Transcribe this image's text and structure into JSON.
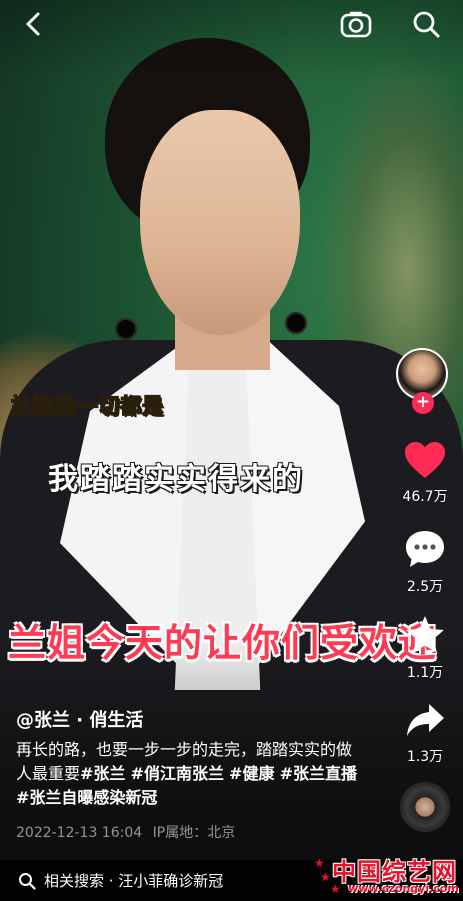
{
  "top_bar": {
    "back_icon": "chevron-left-icon",
    "camera_icon": "camera-icon",
    "search_icon": "search-icon"
  },
  "captions": {
    "line1": "兰姐的一切都是",
    "line2": "我踏踏实实得来的",
    "line3": "兰姐今天的让你们受欢迎"
  },
  "right_rail": {
    "like_count": "46.7万",
    "comment_count": "2.5万",
    "favorite_count": "1.1万",
    "share_count": "1.3万",
    "follow_symbol": "+",
    "colors": {
      "like": "#fe2c55",
      "follow": "#fe2c55"
    }
  },
  "post": {
    "author": "@张兰 · 俏生活",
    "desc_text": "再长的路，也要一步一步的走完，踏踏实实的做人最重要",
    "hashtags": [
      "#张兰",
      "#俏江南张兰",
      "#健康",
      "#张兰直播",
      "#张兰自曝感染新冠"
    ],
    "date": "2022-12-13 16:04",
    "ip_label": "IP属地：北京"
  },
  "related_search": {
    "label": "相关搜索 · 汪小菲确诊新冠",
    "icon": "search-icon"
  },
  "watermark": {
    "title": "中国综艺网",
    "url": "www.czongyi.com",
    "color": "#e4122a"
  }
}
